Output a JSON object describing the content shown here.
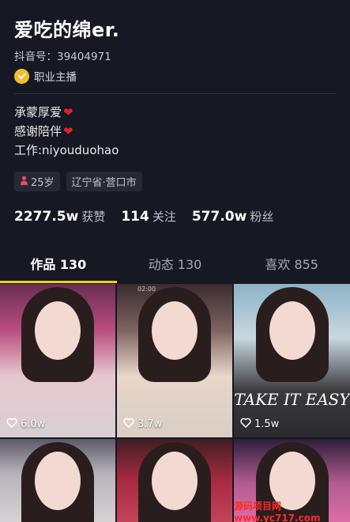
{
  "profile": {
    "name": "爱吃的绵er.",
    "douyin_id": "抖音号：39404971",
    "verification": "职业主播",
    "bio": [
      {
        "text": "承蒙厚爱",
        "heart": true
      },
      {
        "text": "感谢陪伴",
        "heart": true
      },
      {
        "text": "工作:niyouduohao",
        "heart": false
      }
    ],
    "tags": [
      {
        "label": "25岁",
        "icon": "female-icon"
      },
      {
        "label": "辽宁省·营口市",
        "icon": null
      }
    ]
  },
  "stats": [
    {
      "value": "2277.5w",
      "label": "获赞"
    },
    {
      "value": "114",
      "label": "关注"
    },
    {
      "value": "577.0w",
      "label": "粉丝"
    }
  ],
  "tabs": [
    {
      "label": "作品 130",
      "active": true
    },
    {
      "label": "动态 130",
      "active": false
    },
    {
      "label": "喜欢 855",
      "active": false
    }
  ],
  "videos": [
    {
      "likes": "6.0w",
      "overlay": "",
      "timestamp": ""
    },
    {
      "likes": "3.7w",
      "overlay": "",
      "timestamp": "02:00"
    },
    {
      "likes": "1.5w",
      "overlay": "TAKE IT EASY",
      "timestamp": ""
    },
    {
      "likes": "",
      "overlay": "",
      "timestamp": ""
    },
    {
      "likes": "",
      "overlay": "",
      "timestamp": ""
    },
    {
      "likes": "",
      "overlay": "",
      "timestamp": ""
    }
  ],
  "watermark": "源码项目网 www.yc717.com",
  "colors": {
    "background": "#161823",
    "active_tab_indicator": "#face15",
    "heart": "#e0212b",
    "verify_badge": "#f6bd2f"
  }
}
